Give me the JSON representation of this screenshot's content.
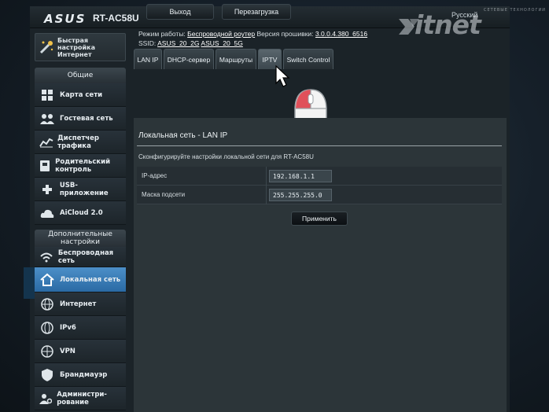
{
  "header": {
    "brand": "ASUS",
    "model": "RT-AC58U",
    "logout_label": "Выход",
    "reboot_label": "Перезагрузка",
    "language": "Русский"
  },
  "watermark": {
    "text": "itnet",
    "small": "СЕТЕВЫЕ ТЕХНОЛОГИИ"
  },
  "sidebar": {
    "quick_setup": "Быстрая настройка Интернет",
    "general_title": "Общие",
    "general": [
      {
        "label": "Карта сети",
        "icon": "network-map-icon"
      },
      {
        "label": "Гостевая сеть",
        "icon": "guest-network-icon"
      },
      {
        "label": "Диспетчер трафика",
        "icon": "traffic-manager-icon"
      },
      {
        "label": "Родительский контроль",
        "icon": "parental-control-icon"
      },
      {
        "label": "USB-приложение",
        "icon": "usb-app-icon"
      },
      {
        "label": "AiCloud 2.0",
        "icon": "aicloud-icon"
      }
    ],
    "advanced_title": "Дополнительные настройки",
    "advanced": [
      {
        "label": "Беспроводная сеть",
        "icon": "wireless-icon"
      },
      {
        "label": "Локальная сеть",
        "icon": "home-icon"
      },
      {
        "label": "Интернет",
        "icon": "globe-icon"
      },
      {
        "label": "IPv6",
        "icon": "ipv6-icon"
      },
      {
        "label": "VPN",
        "icon": "vpn-icon"
      },
      {
        "label": "Брандмауэр",
        "icon": "firewall-icon"
      },
      {
        "label": "Администри-рование",
        "icon": "admin-icon"
      }
    ]
  },
  "status": {
    "mode_label": "Режим работы:",
    "mode_value": "Беспроводной роутер",
    "firmware_label": "Версия прошивки:",
    "firmware_value": "3.0.0.4.380_6516",
    "ssid_label": "SSID:",
    "ssid_1": "ASUS_20_2G",
    "ssid_2": "ASUS_20_5G"
  },
  "tabs": [
    "LAN IP",
    "DHCP-сервер",
    "Маршруты",
    "IPTV",
    "Switch Control"
  ],
  "main": {
    "title": "Локальная сеть - LAN IP",
    "description": "Сконфигурируйте настройки локальной сети для RT-AC58U",
    "ip_label": "IP-адрес",
    "ip_value": "192.168.1.1",
    "mask_label": "Маска подсети",
    "mask_value": "255.255.255.0",
    "apply_label": "Применить"
  },
  "colors": {
    "accent": "#3a7dbc",
    "panel": "#2c3539",
    "mouse_button": "#e0505a"
  }
}
